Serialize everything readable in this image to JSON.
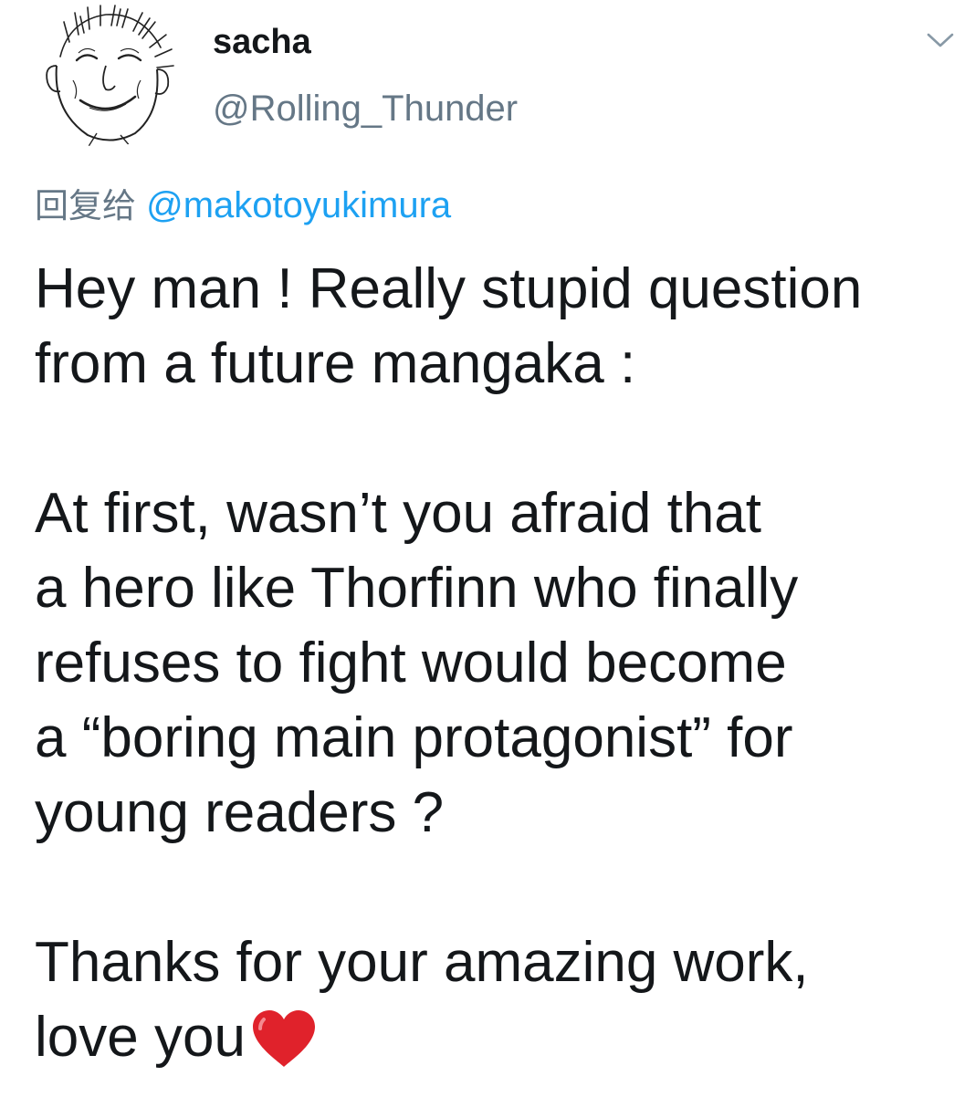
{
  "tweet": {
    "author": {
      "display_name": "sacha",
      "handle": "@Rolling_Thunder",
      "avatar_icon": "manga-face-avatar"
    },
    "more_icon": "chevron-down-icon",
    "reply": {
      "prefix": "回复给",
      "mention": "@makotoyukimura"
    },
    "body": {
      "para1": [
        "Hey man ! Really stupid question",
        "from a future mangaka :"
      ],
      "para2": [
        "At first, wasn’t you afraid that",
        "a hero like Thorfinn who finally",
        "refuses to fight would become",
        "a “boring main protagonist” for",
        "young readers ?"
      ],
      "para3": [
        "Thanks for your amazing work,",
        "love you"
      ],
      "emoji": "red-heart-icon"
    },
    "colors": {
      "text": "#14171a",
      "secondary": "#657786",
      "link": "#1da1f2",
      "heart": "#e0222b"
    }
  }
}
